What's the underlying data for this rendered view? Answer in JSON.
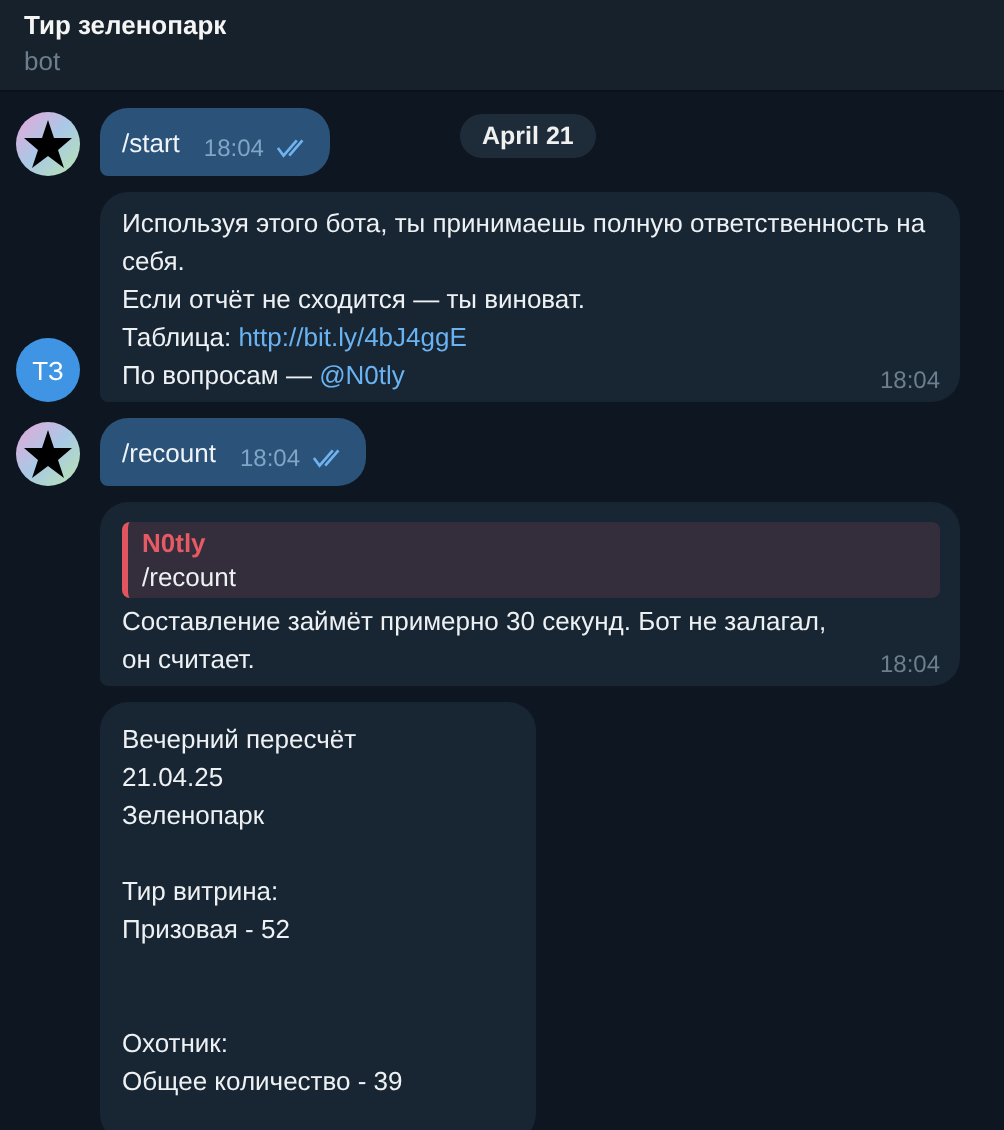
{
  "header": {
    "title": "Тир зеленопарк",
    "subtitle": "bot"
  },
  "date_pill": "April 21",
  "messages": [
    {
      "kind": "out",
      "avatar": {
        "kind": "star"
      },
      "text": "/start",
      "time": "18:04",
      "read": true
    },
    {
      "kind": "in",
      "avatar": {
        "kind": "initials",
        "text": "ТЗ"
      },
      "lines": [
        {
          "text": "Используя этого бота, ты принимаешь полную ответственность на себя."
        },
        {
          "text": "Если отчёт не сходится — ты виноват."
        },
        {
          "text": "Таблица: ",
          "link": "http://bit.ly/4bJ4ggE"
        },
        {
          "text": "По вопросам — ",
          "link": "@N0tly"
        }
      ],
      "time": "18:04"
    },
    {
      "kind": "out",
      "avatar": {
        "kind": "star"
      },
      "text": "/recount",
      "time": "18:04",
      "read": true
    },
    {
      "kind": "in",
      "quote": {
        "author": "N0tly",
        "text": "/recount"
      },
      "lines": [
        {
          "text": "Составление займёт примерно 30 секунд. Бот не залагал, он считает."
        }
      ],
      "time": "18:04"
    },
    {
      "kind": "report",
      "blocks": [
        {
          "kind": "paragraph",
          "lines": [
            "Вечерний пересчёт",
            "21.04.25",
            "Зеленопарк"
          ]
        },
        {
          "kind": "paragraph",
          "lines": [
            "Тир витрина:",
            "Призовая - 52"
          ]
        },
        {
          "kind": "paragraph_after_wide_gap",
          "lines": [
            "Охотник:",
            "Общее количество - 39"
          ]
        }
      ]
    }
  ]
}
